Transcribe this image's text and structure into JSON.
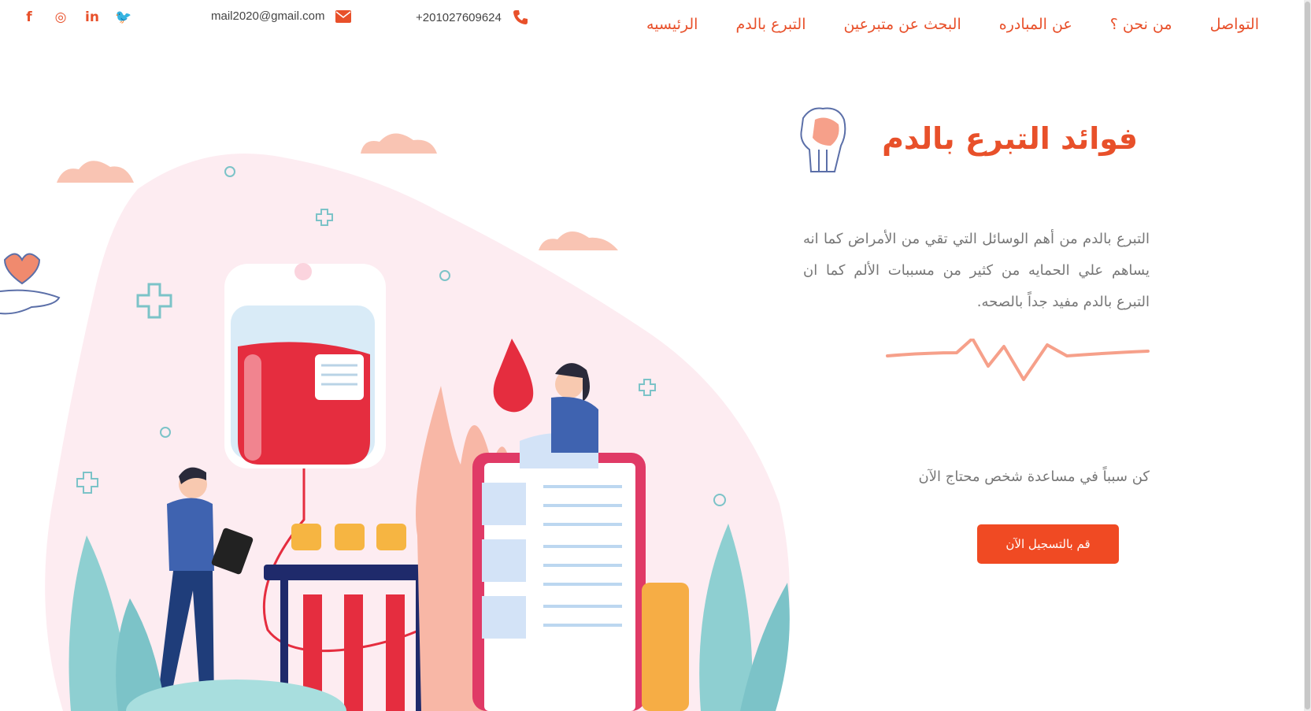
{
  "header": {
    "social": [
      {
        "icon": "facebook-icon",
        "label": "f"
      },
      {
        "icon": "instagram-icon",
        "label": "◎"
      },
      {
        "icon": "linkedin-icon",
        "label": "in"
      },
      {
        "icon": "twitter-icon",
        "label": "🐦"
      }
    ],
    "email": "mail2020@gmail.com",
    "phone": "+201027609624",
    "nav": [
      {
        "label": "الرئيسيه"
      },
      {
        "label": "التبرع بالدم"
      },
      {
        "label": "البحث عن متبرعين"
      },
      {
        "label": "عن المبادره"
      },
      {
        "label": "من نحن ؟"
      },
      {
        "label": "التواصل"
      }
    ]
  },
  "hero": {
    "title": "فوائد التبرع بالدم",
    "paragraph": "التبرع بالدم من أهم الوسائل التي تقي من الأمراض كما انه يساهم علي الحمايه من كثير من مسببات الألم كما ان التبرع بالدم مفيد جداً بالصحه.",
    "slogan": "كن سبباً في مساعدة شخص محتاج الآن",
    "cta_label": "قم بالتسجيل الآن"
  },
  "colors": {
    "accent": "#e8502a",
    "button": "#f04a23",
    "text_muted": "#777777",
    "blob": "#fde8ee",
    "teal": "#7cc3c8",
    "blood": "#e52d3f"
  }
}
